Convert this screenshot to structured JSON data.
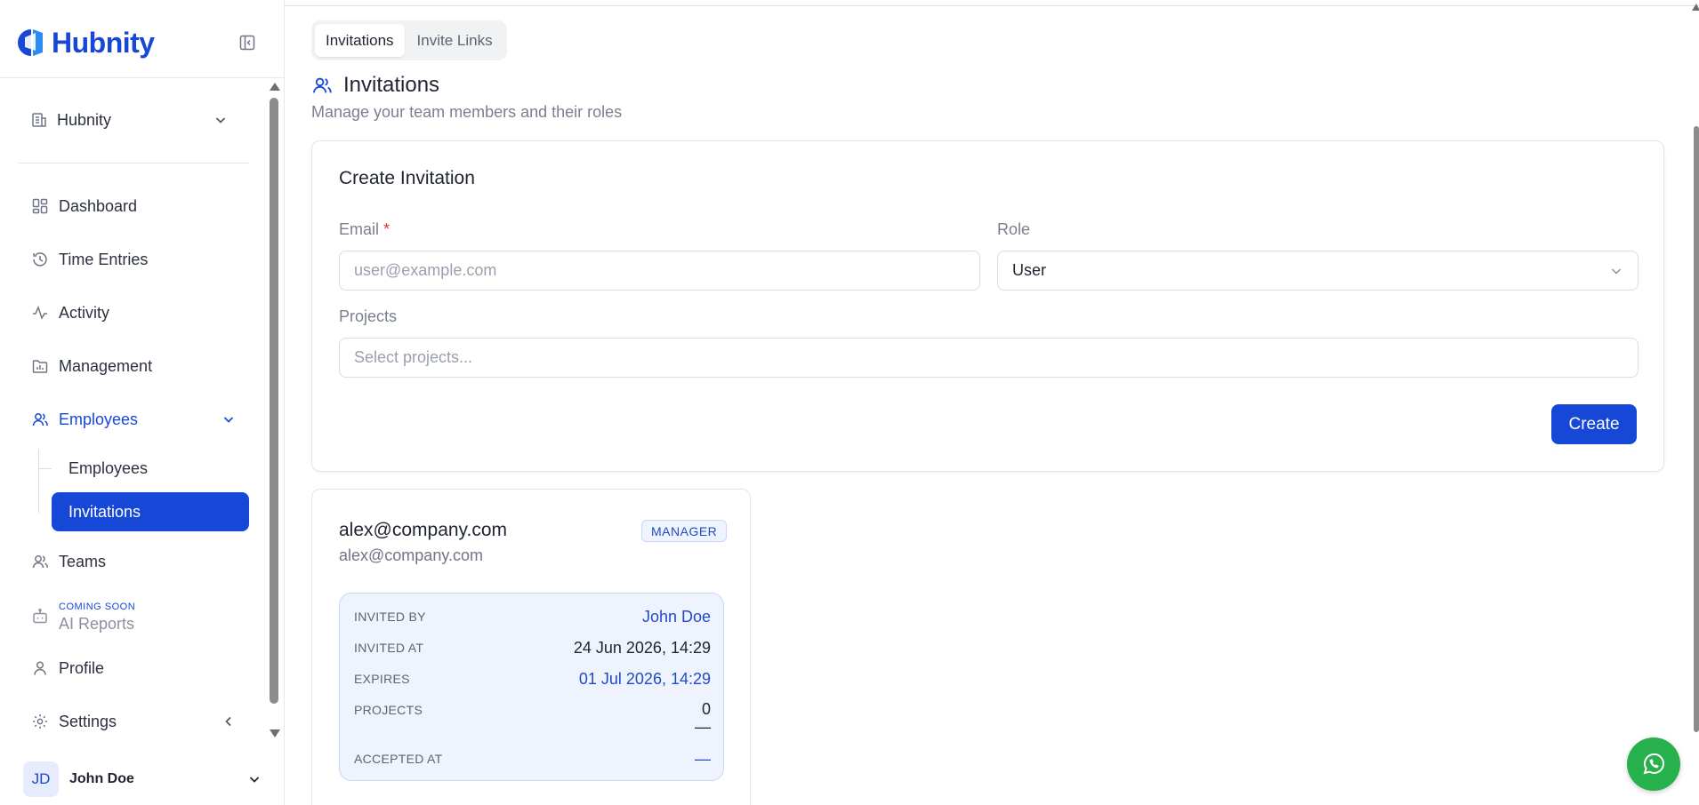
{
  "brand": {
    "name": "Hubnity"
  },
  "sidebar": {
    "org_select": "Hubnity",
    "items": [
      {
        "label": "Dashboard"
      },
      {
        "label": "Time Entries"
      },
      {
        "label": "Activity"
      },
      {
        "label": "Management"
      },
      {
        "label": "Employees"
      },
      {
        "label": "Teams"
      },
      {
        "label": "AI Reports",
        "badge": "COMING SOON"
      },
      {
        "label": "Profile"
      },
      {
        "label": "Settings"
      }
    ],
    "sub_items": [
      {
        "label": "Employees"
      },
      {
        "label": "Invitations"
      }
    ],
    "user": {
      "initials": "JD",
      "name": "John Doe"
    }
  },
  "tabs": [
    {
      "label": "Invitations"
    },
    {
      "label": "Invite Links"
    }
  ],
  "page": {
    "title": "Invitations",
    "subtitle": "Manage your team members and their roles"
  },
  "create_form": {
    "title": "Create Invitation",
    "email_label": "Email",
    "required_mark": "*",
    "email_placeholder": "user@example.com",
    "role_label": "Role",
    "role_value": "User",
    "projects_label": "Projects",
    "projects_placeholder": "Select projects...",
    "create_button": "Create"
  },
  "invitation": {
    "email": "alex@company.com",
    "email_sub": "alex@company.com",
    "role": "MANAGER",
    "invited_by_label": "INVITED BY",
    "invited_by": "John Doe",
    "invited_at_label": "INVITED AT",
    "invited_at": "24 Jun 2026, 14:29",
    "expires_label": "EXPIRES",
    "expires": "01 Jul 2026, 14:29",
    "projects_label": "PROJECTS",
    "projects": "0",
    "projects_dash": "—",
    "accepted_at_label": "ACCEPTED AT",
    "accepted_at": "—"
  },
  "colors": {
    "accent": "#1747d6",
    "whatsapp": "#27b14c"
  }
}
